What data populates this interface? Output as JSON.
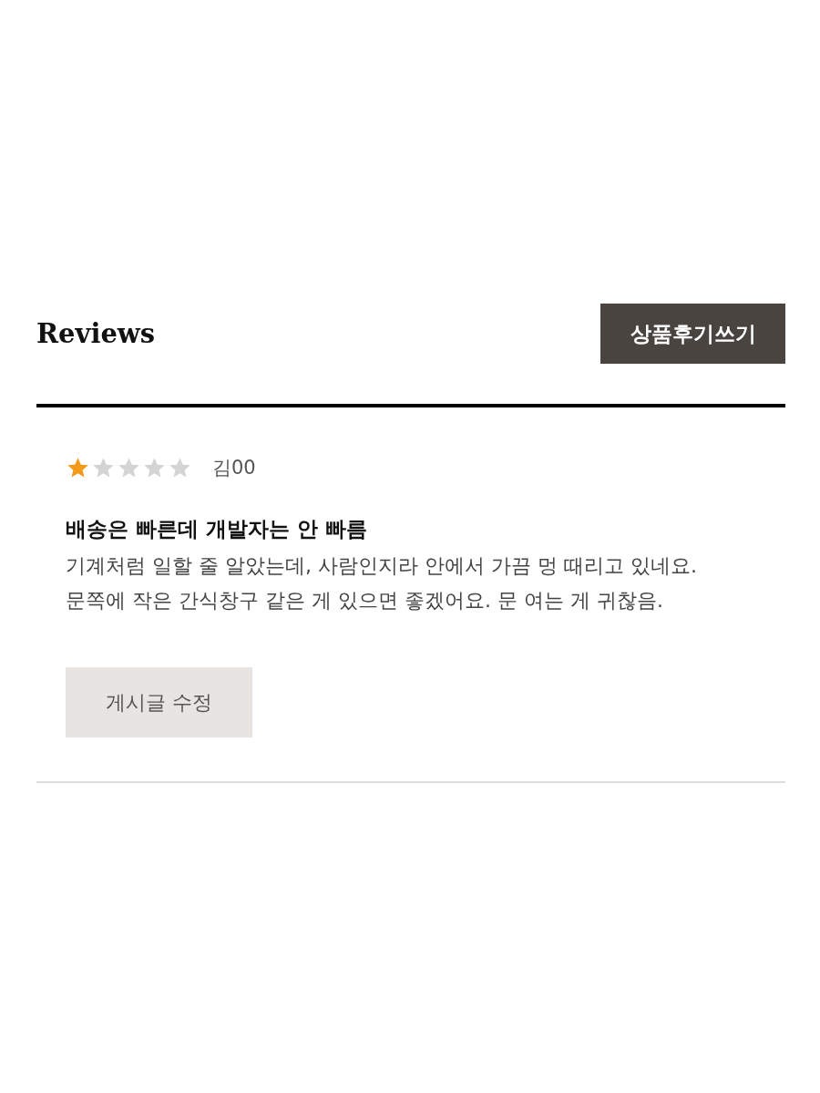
{
  "section": {
    "title": "Reviews",
    "write_button": "상품후기쓰기"
  },
  "reviews": [
    {
      "stars": 1,
      "author": "김00",
      "title": "배송은 빠른데 개발자는 안 빠름",
      "body_lines": [
        "기계처럼 일할 줄 알았는데, 사람인지라 안에서 가끔 멍 때리고 있네요.",
        "문쪽에 작은 간식창구 같은 게 있으면 좋겠어요. 문 여는 게 귀찮음."
      ],
      "edit_button": "게시글 수정"
    }
  ]
}
